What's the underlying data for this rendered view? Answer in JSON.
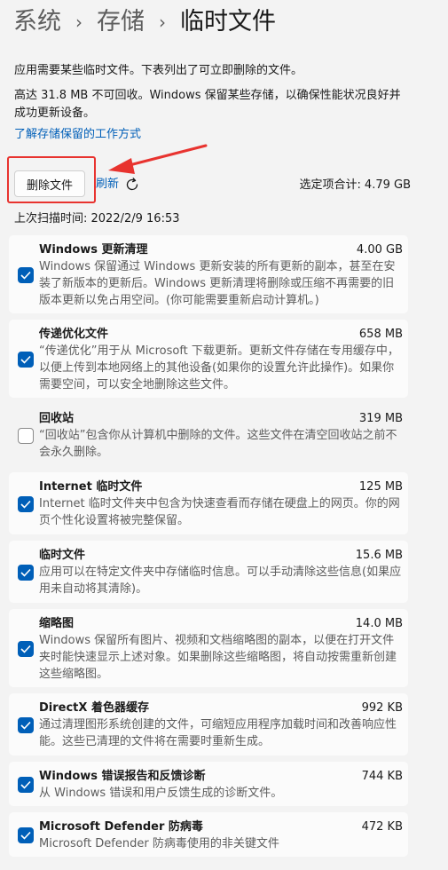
{
  "breadcrumb": {
    "level1": "系统",
    "level2": "存储",
    "current": "临时文件",
    "separator": "›"
  },
  "intro": {
    "line1": "应用需要某些临时文件。下表列出了可立即删除的文件。",
    "line2": "高达 31.8 MB 不可回收。Windows 保留某些存储，以确保性能状况良好并成功更新设备。"
  },
  "learn_more_link": "了解存储保留的工作方式",
  "actions": {
    "delete_label": "删除文件",
    "refresh_label": "刷新"
  },
  "selected_total": {
    "label": "选定项合计:",
    "value": "4.79 GB"
  },
  "last_scan": "上次扫描时间: 2022/2/9 16:53",
  "accent_color": "#005fb8",
  "annotation_color": "#e8332f",
  "items": [
    {
      "name": "windows-update-cleanup",
      "title": "Windows 更新清理",
      "size": "4.00 GB",
      "checked": true,
      "description": "Windows 保留通过 Windows 更新安装的所有更新的副本，甚至在安装了新版本的更新后。Windows 更新清理将删除或压缩不再需要的旧版本更新以免占用空间。(你可能需要重新启动计算机。)"
    },
    {
      "name": "delivery-optimization-files",
      "title": "传递优化文件",
      "size": "658 MB",
      "checked": true,
      "description": "“传递优化”用于从 Microsoft 下载更新。更新文件存储在专用缓存中，以便上传到本地网络上的其他设备(如果你的设置允许此操作)。如果你需要空间，可以安全地删除这些文件。"
    },
    {
      "name": "recycle-bin",
      "title": "回收站",
      "size": "319 MB",
      "checked": false,
      "description": "“回收站”包含你从计算机中删除的文件。这些文件在清空回收站之前不会永久删除。"
    },
    {
      "name": "internet-temp-files",
      "title": "Internet 临时文件",
      "size": "125 MB",
      "checked": true,
      "description": "Internet 临时文件夹中包含为快速查看而存储在硬盘上的网页。你的网页个性化设置将被完整保留。"
    },
    {
      "name": "temporary-files",
      "title": "临时文件",
      "size": "15.6 MB",
      "checked": true,
      "description": "应用可以在特定文件夹中存储临时信息。可以手动清除这些信息(如果应用未自动将其清除)。"
    },
    {
      "name": "thumbnails",
      "title": "缩略图",
      "size": "14.0 MB",
      "checked": true,
      "description": "Windows 保留所有图片、视频和文档缩略图的副本，以便在打开文件夹时能快速显示上述对象。如果删除这些缩略图，将自动按需重新创建这些缩略图。"
    },
    {
      "name": "directx-shader-cache",
      "title": "DirectX 着色器缓存",
      "size": "992 KB",
      "checked": true,
      "description": "通过清理图形系统创建的文件，可缩短应用程序加载时间和改善响应性能。这些已清理的文件将在需要时重新生成。"
    },
    {
      "name": "windows-error-reporting",
      "title": "Windows 错误报告和反馈诊断",
      "size": "744 KB",
      "checked": true,
      "description": "从 Windows 错误和用户反馈生成的诊断文件。"
    },
    {
      "name": "defender-antivirus",
      "title": "Microsoft Defender 防病毒",
      "size": "472 KB",
      "checked": true,
      "description": "Microsoft Defender 防病毒使用的非关键文件"
    }
  ]
}
